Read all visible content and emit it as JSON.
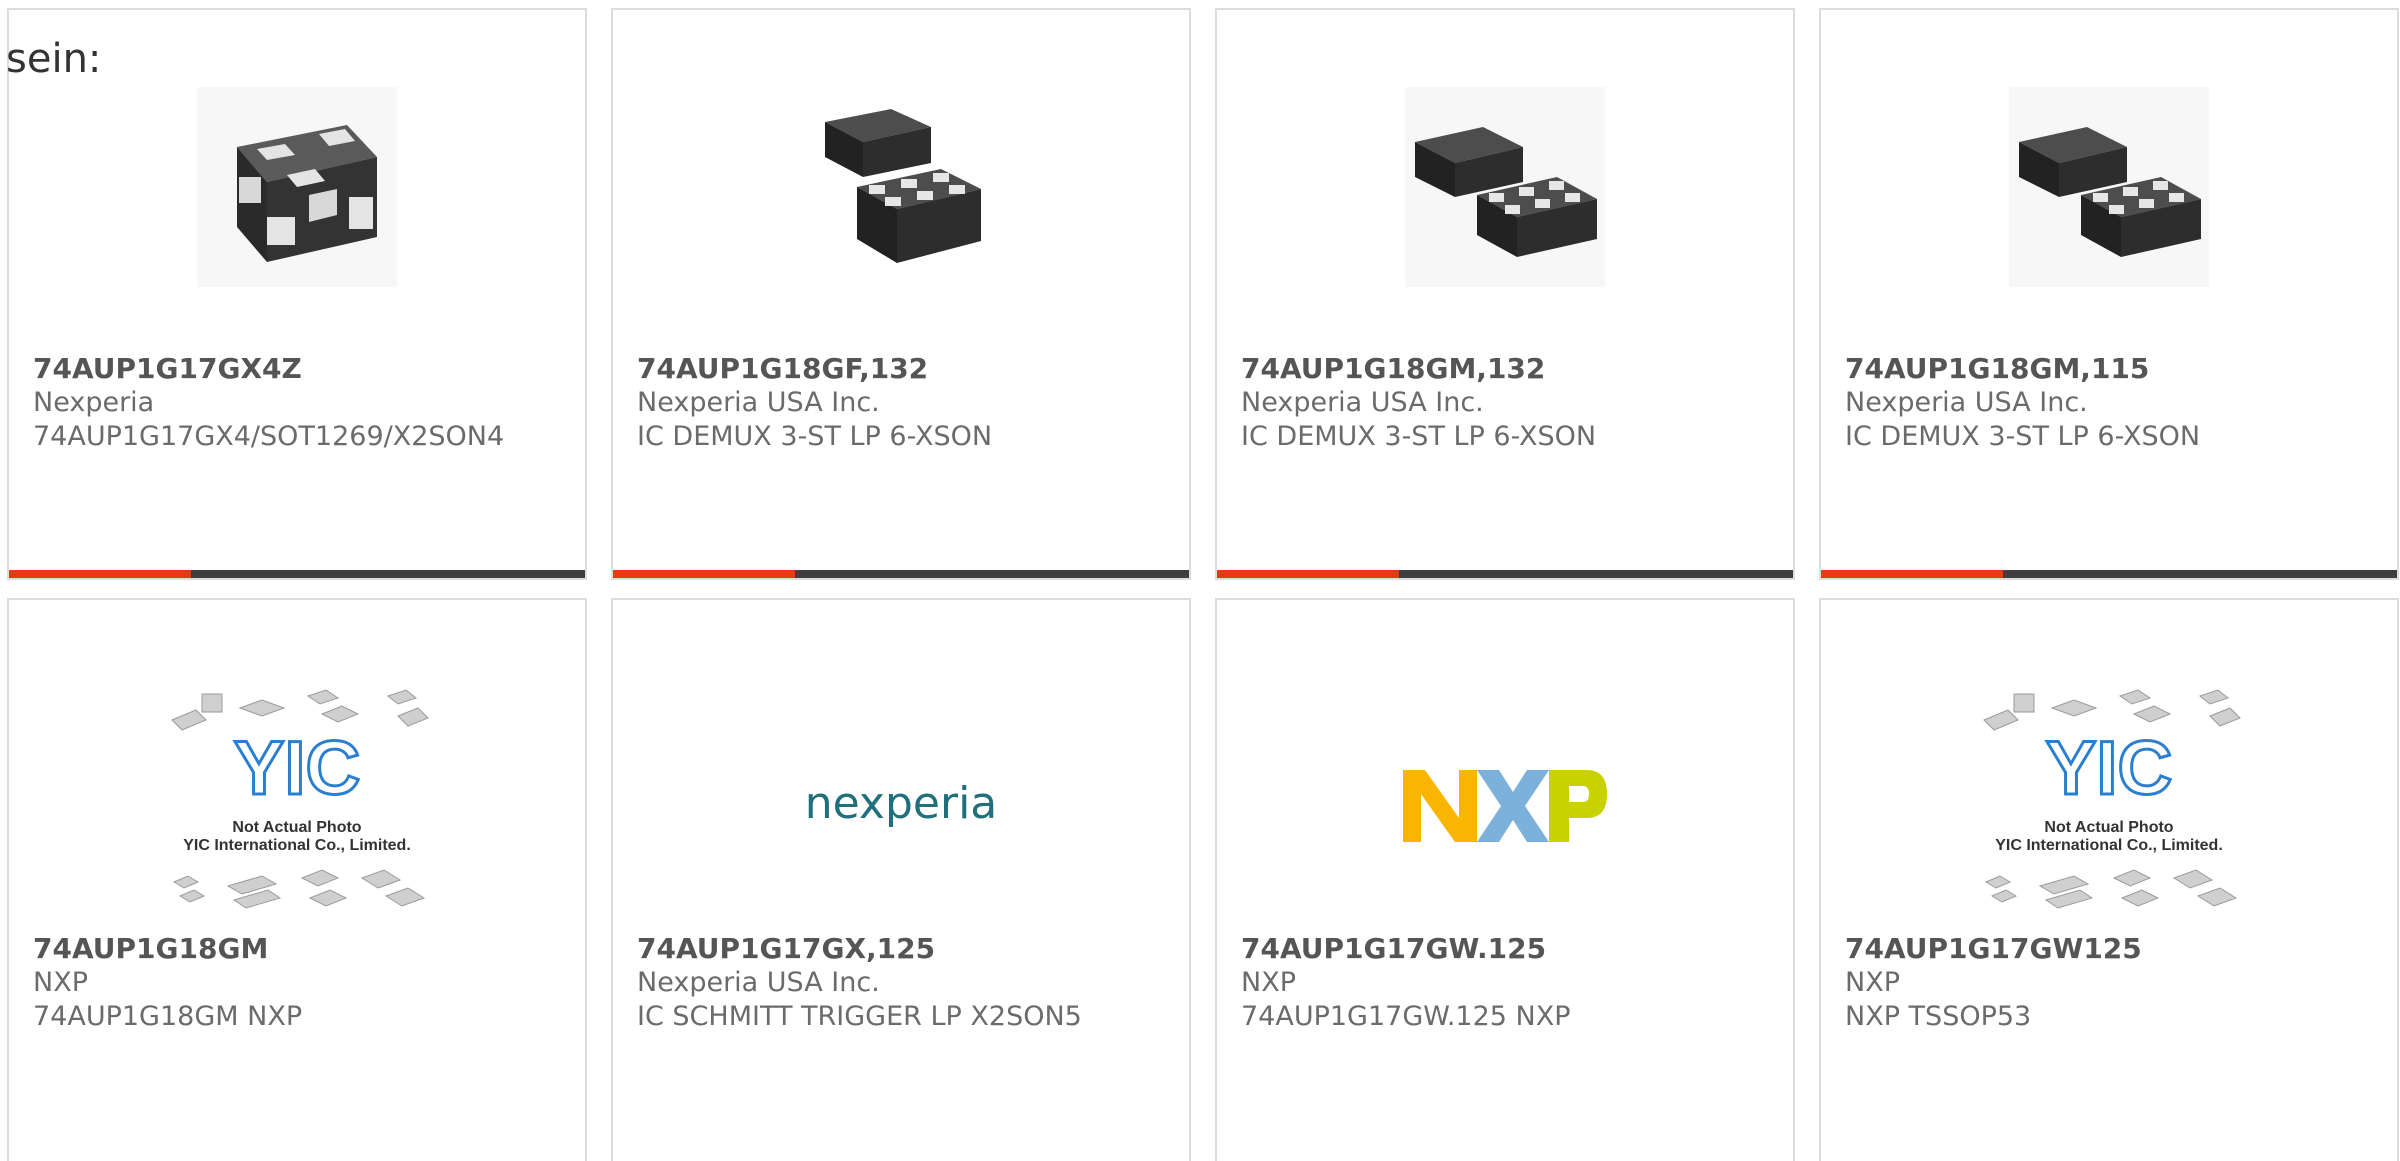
{
  "intro_text": "sein:",
  "colors": {
    "accent": "#e73a12",
    "bar": "#3e3e3e",
    "border": "#dcdcdc"
  },
  "products": [
    {
      "part": "74AUP1G17GX4Z",
      "manufacturer": "Nexperia",
      "description": "74AUP1G17GX4/SOT1269/X2SON4",
      "image": "chip-4pad-icon"
    },
    {
      "part": "74AUP1G18GF,132",
      "manufacturer": "Nexperia USA Inc.",
      "description": "IC DEMUX 3-ST LP 6-XSON",
      "image": "chip-pair-icon"
    },
    {
      "part": "74AUP1G18GM,132",
      "manufacturer": "Nexperia USA Inc.",
      "description": "IC DEMUX 3-ST LP 6-XSON",
      "image": "chip-pair-icon"
    },
    {
      "part": "74AUP1G18GM,115",
      "manufacturer": "Nexperia USA Inc.",
      "description": "IC DEMUX 3-ST LP 6-XSON",
      "image": "chip-pair-icon"
    },
    {
      "part": "74AUP1G18GM",
      "manufacturer": "NXP",
      "description": "74AUP1G18GM NXP",
      "image": "yic-placeholder",
      "placeholder": {
        "line1": "Not Actual Photo",
        "line2": "YIC International Co., Limited."
      }
    },
    {
      "part": "74AUP1G17GX,125",
      "manufacturer": "Nexperia USA Inc.",
      "description": "IC SCHMITT TRIGGER LP X2SON5",
      "image": "nexperia-logo",
      "logo_text": "nexperia"
    },
    {
      "part": "74AUP1G17GW.125",
      "manufacturer": "NXP",
      "description": "74AUP1G17GW.125 NXP",
      "image": "nxp-logo"
    },
    {
      "part": "74AUP1G17GW125",
      "manufacturer": "NXP",
      "description": "NXP TSSOP53",
      "image": "yic-placeholder",
      "placeholder": {
        "line1": "Not Actual Photo",
        "line2": "YIC International Co., Limited."
      }
    }
  ]
}
